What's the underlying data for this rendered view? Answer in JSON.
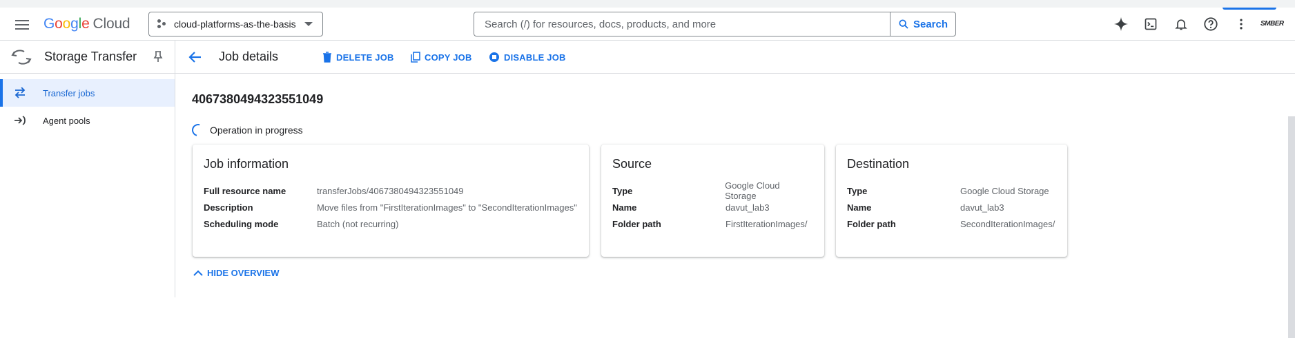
{
  "topbar": {
    "logo_letters": [
      "G",
      "o",
      "o",
      "g",
      "l",
      "e"
    ],
    "logo_suffix": "Cloud",
    "project_name": "cloud-platforms-as-the-basis",
    "search_placeholder": "Search (/) for resources, docs, products, and more",
    "search_button": "Search",
    "brand_text": "SMBER",
    "icons": [
      "gemini-spark-icon",
      "cloud-shell-icon",
      "notifications-icon",
      "help-icon",
      "more-vert-icon"
    ]
  },
  "leftnav": {
    "product_title": "Storage Transfer",
    "items": [
      {
        "label": "Transfer jobs",
        "icon": "transfer-arrows-icon",
        "active": true
      },
      {
        "label": "Agent pools",
        "icon": "agent-pools-icon",
        "active": false
      }
    ]
  },
  "main": {
    "page_title": "Job details",
    "actions": {
      "delete": "DELETE JOB",
      "copy": "COPY JOB",
      "disable": "DISABLE JOB"
    },
    "job_id": "4067380494323551049",
    "status": "Operation in progress",
    "cards": {
      "job_info": {
        "title": "Job information",
        "rows": [
          {
            "key": "Full resource name",
            "value": "transferJobs/4067380494323551049"
          },
          {
            "key": "Description",
            "value": "Move files from \"FirstIterationImages\" to \"SecondIterationImages\""
          },
          {
            "key": "Scheduling mode",
            "value": "Batch (not recurring)"
          }
        ]
      },
      "source": {
        "title": "Source",
        "rows": [
          {
            "key": "Type",
            "value": "Google Cloud Storage"
          },
          {
            "key": "Name",
            "value": "davut_lab3"
          },
          {
            "key": "Folder path",
            "value": "FirstIterationImages/"
          }
        ]
      },
      "destination": {
        "title": "Destination",
        "rows": [
          {
            "key": "Type",
            "value": "Google Cloud Storage"
          },
          {
            "key": "Name",
            "value": "davut_lab3"
          },
          {
            "key": "Folder path",
            "value": "SecondIterationImages/"
          }
        ]
      }
    },
    "hide_overview": "HIDE OVERVIEW"
  },
  "colors": {
    "accent": "#1a73e8",
    "active_bg": "#e8f0fe",
    "border": "#dadce0",
    "muted_text": "#5f6368"
  }
}
